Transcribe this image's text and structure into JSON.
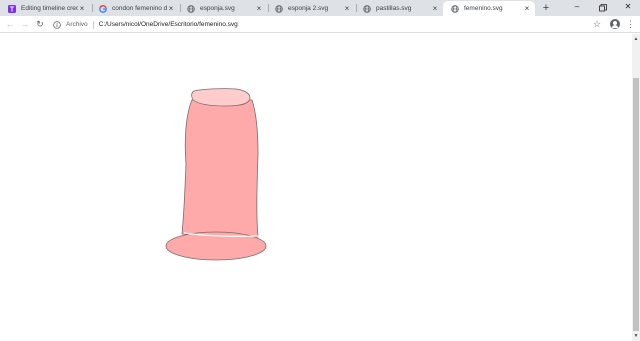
{
  "tabs": [
    {
      "title": "Editing timeline crecimi",
      "icon": "tumblr-t-icon",
      "active": false
    },
    {
      "title": "condon femenino dibuj",
      "icon": "google-g-icon",
      "active": false
    },
    {
      "title": "esponja.svg",
      "icon": "globe-icon",
      "active": false
    },
    {
      "title": "esponja 2.svg",
      "icon": "globe-icon",
      "active": false
    },
    {
      "title": "pastillas.svg",
      "icon": "globe-icon",
      "active": false
    },
    {
      "title": "femenino.svg",
      "icon": "globe-icon",
      "active": true
    }
  ],
  "toolbar": {
    "scheme_label": "Archivo",
    "url": "C:/Users/nicol/OneDrive/Escritorio/femenino.svg"
  },
  "colors": {
    "tab_strip": "#dee1e6",
    "shape_fill": "#ffaaaa",
    "shape_top_fill": "#ffcccc",
    "shape_stroke": "#7a6a6a",
    "scroll_thumb": "#c1c1c1"
  }
}
